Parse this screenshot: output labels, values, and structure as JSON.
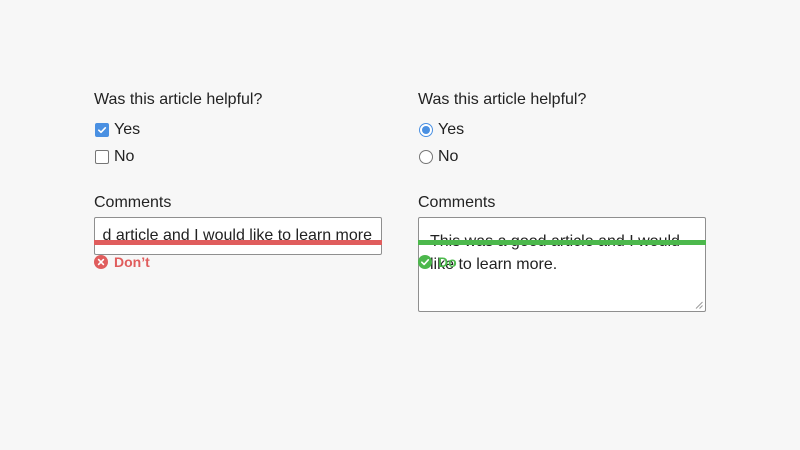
{
  "colors": {
    "accent": "#4a90e2",
    "dont": "#e05d5d",
    "do": "#4cb84c"
  },
  "dont_example": {
    "question": "Was this article helpful?",
    "options": [
      {
        "label": "Yes",
        "checked": true
      },
      {
        "label": "No",
        "checked": false
      }
    ],
    "comments_label": "Comments",
    "comment_value": "This was a good article and I would like to learn more.",
    "verdict": "Don’t",
    "verdict_icon": "close-circle-icon"
  },
  "do_example": {
    "question": "Was this article helpful?",
    "options": [
      {
        "label": "Yes",
        "checked": true
      },
      {
        "label": "No",
        "checked": false
      }
    ],
    "comments_label": "Comments",
    "comment_value": "This was a good article and I would like to learn more.",
    "verdict": "Do",
    "verdict_icon": "check-circle-icon"
  }
}
